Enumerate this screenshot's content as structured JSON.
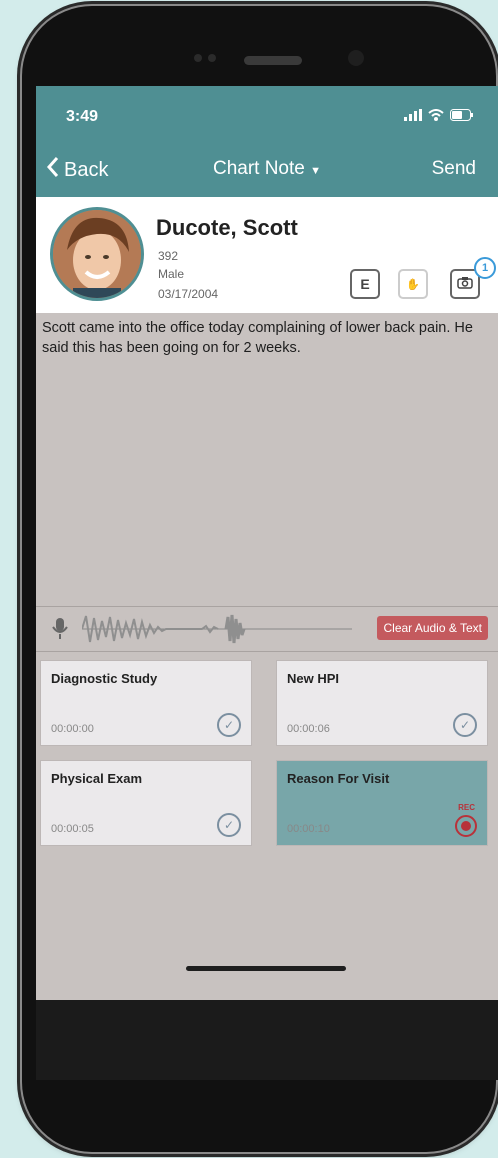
{
  "status": {
    "time": "3:49"
  },
  "nav": {
    "back_label": "Back",
    "title": "Chart Note",
    "send_label": "Send"
  },
  "patient": {
    "name": "Ducote, Scott",
    "id": "392",
    "sex": "Male",
    "dob": "03/17/2004",
    "buttons": {
      "e_label": "E",
      "photo_badge": "1"
    }
  },
  "note": {
    "text": "Scott came into the office today complaining of lower back pain. He said this has been going on for 2 weeks."
  },
  "audio": {
    "clear_label": "Clear Audio & Text"
  },
  "cards": [
    {
      "title": "Diagnostic Study",
      "time": "00:00:00",
      "state": "done"
    },
    {
      "title": "New HPI",
      "time": "00:00:06",
      "state": "done"
    },
    {
      "title": "Physical Exam",
      "time": "00:00:05",
      "state": "done"
    },
    {
      "title": "Reason For Visit",
      "time": "00:00:10",
      "state": "recording",
      "rec_label": "REC"
    }
  ],
  "colors": {
    "teal": "#4f8f93",
    "rec": "#c45a5e"
  }
}
